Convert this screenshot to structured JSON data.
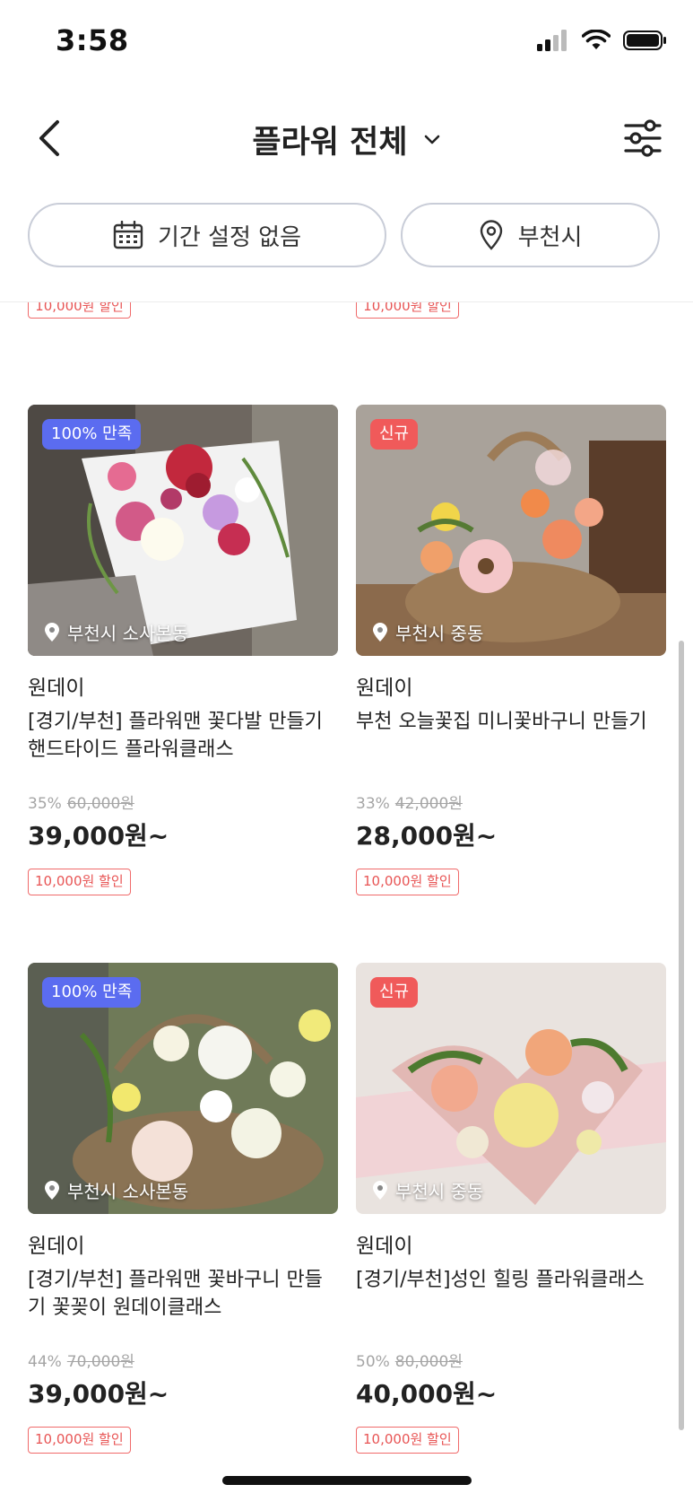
{
  "status": {
    "time": "3:58"
  },
  "header": {
    "title": "플라워 전체",
    "back_icon": "chevron-left-icon",
    "filter_icon": "sliders-icon"
  },
  "filters": {
    "date_label": "기간 설정 없음",
    "location_label": "부천시"
  },
  "partial_row": {
    "coupon_left": "10,000원 할인",
    "coupon_right": "10,000원 할인"
  },
  "products": [
    {
      "tag": "100% 만족",
      "tag_type": "sat",
      "location": "부천시 소사본동",
      "brand": "원데이",
      "name": "[경기/부천]  플라워맨 꽃다발 만들기 핸드타이드 플라워클래스",
      "discount": "35%",
      "original_price": "60,000원",
      "price": "39,000원~",
      "coupon": "10,000원 할인"
    },
    {
      "tag": "신규",
      "tag_type": "new",
      "location": "부천시 중동",
      "brand": "원데이",
      "name": "부천  오늘꽃집 미니꽃바구니 만들기",
      "discount": "33%",
      "original_price": "42,000원",
      "price": "28,000원~",
      "coupon": "10,000원 할인"
    },
    {
      "tag": "100% 만족",
      "tag_type": "sat",
      "location": "부천시 소사본동",
      "brand": "원데이",
      "name": "[경기/부천] 플라워맨 꽃바구니 만들기 꽃꽂이 원데이클래스",
      "discount": "44%",
      "original_price": "70,000원",
      "price": "39,000원~",
      "coupon": "10,000원 할인"
    },
    {
      "tag": "신규",
      "tag_type": "new",
      "location": "부천시 중동",
      "brand": "원데이",
      "name": "[경기/부천]성인 힐링 플라워클래스",
      "discount": "50%",
      "original_price": "80,000원",
      "price": "40,000원~",
      "coupon": "10,000원 할인"
    }
  ]
}
